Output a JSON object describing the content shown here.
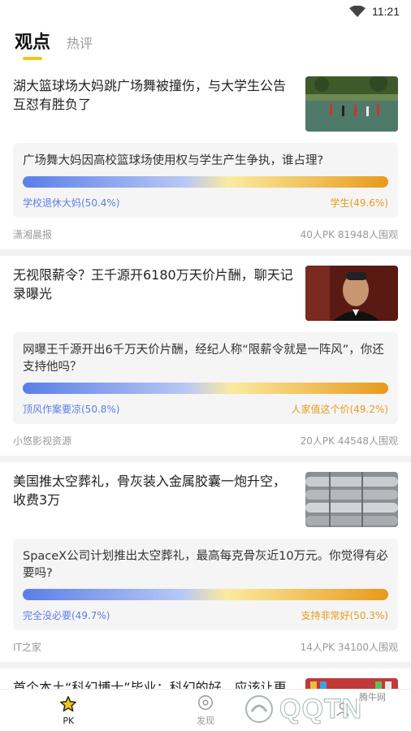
{
  "status": {
    "time": "11:21"
  },
  "tabs": [
    {
      "label": "观点",
      "active": true
    },
    {
      "label": "热评",
      "active": false
    }
  ],
  "cards": [
    {
      "title": "湖大篮球场大妈跳广场舞被撞伤，与大学生公告互怼有胜负了",
      "thumb": "basketball-court-photo",
      "question": "广场舞大妈因高校篮球场使用权与学生产生争执，谁占理?",
      "left_label": "学校退休大妈(50.4%)",
      "right_label": "学生(49.6%)",
      "left_percent": 50.4,
      "source": "潇湘晨报",
      "stats": "40人PK  81948人围观"
    },
    {
      "title": "无视限薪令？王千源开6180万天价片酬，聊天记录曝光",
      "thumb": "actor-portrait-photo",
      "question": "网曝王千源开出6千万天价片酬，经纪人称“限薪令就是一阵风”，你还支持他吗？",
      "left_label": "顶风作案要凉(50.8%)",
      "right_label": "人家值这个价(49.2%)",
      "left_percent": 50.8,
      "source": "小悠影视资源",
      "stats": "20人PK  44548人围观"
    },
    {
      "title": "美国推太空葬礼，骨灰装入金属胶囊一炮升空，收费3万",
      "thumb": "metal-capsules-photo",
      "question": "SpaceX公司计划推出太空葬礼，最高每克骨灰近10万元。你觉得有必要吗?",
      "left_label": "完全没必要(49.7%)",
      "right_label": "支持非常好(50.3%)",
      "left_percent": 49.7,
      "source": "IT之家",
      "stats": "14人PK  34100人围观"
    },
    {
      "title": "首个本土“科幻博士”毕业：科幻的好，应该让更",
      "thumb": "person-bookshelf-photo"
    }
  ],
  "nav": [
    {
      "label": "PK",
      "icon": "star-icon",
      "active": true
    },
    {
      "label": "发现",
      "icon": "discover-icon",
      "active": false
    },
    {
      "label": "",
      "icon": "user-icon",
      "active": false
    }
  ],
  "watermark": {
    "text": "QQTN",
    "small": "腾牛网"
  },
  "colors": {
    "accent": "#f5c518",
    "left": "#5a7ee8",
    "right": "#e89a1c"
  }
}
